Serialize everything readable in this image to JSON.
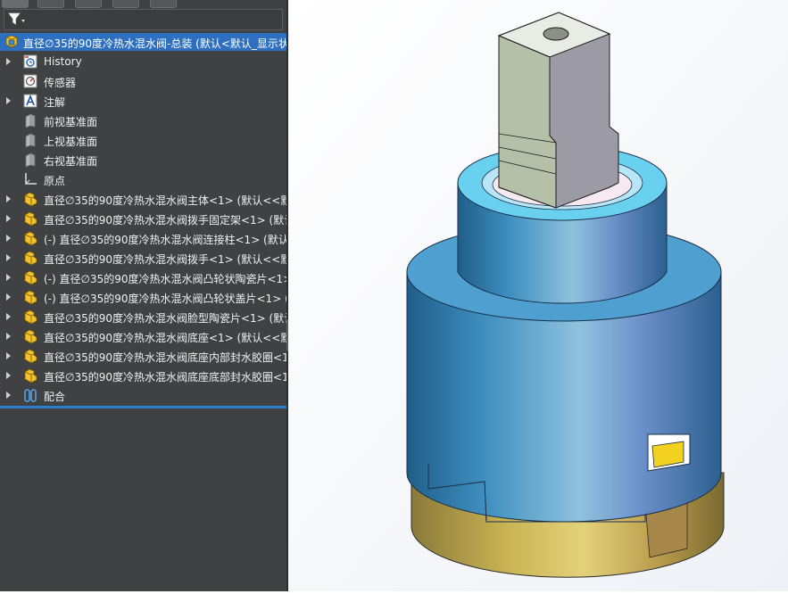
{
  "feature_tree": {
    "root": {
      "label": "直径∅35的90度冷热水混水阀-总装  (默认<默认_显示状"
    },
    "items": [
      {
        "label": "History",
        "icon": "history-icon",
        "expandable": true
      },
      {
        "label": "传感器",
        "icon": "sensor-icon",
        "expandable": false
      },
      {
        "label": "注解",
        "icon": "annotation-icon",
        "expandable": true
      },
      {
        "label": "前视基准面",
        "icon": "plane-icon",
        "expandable": false
      },
      {
        "label": "上视基准面",
        "icon": "plane-icon",
        "expandable": false
      },
      {
        "label": "右视基准面",
        "icon": "plane-icon",
        "expandable": false
      },
      {
        "label": "原点",
        "icon": "origin-icon",
        "expandable": false
      },
      {
        "label": "直径∅35的90度冷热水混水阀主体<1> (默认<<默",
        "icon": "part-icon",
        "expandable": true
      },
      {
        "label": "直径∅35的90度冷热水混水阀拨手固定架<1> (默认",
        "icon": "part-icon",
        "expandable": true
      },
      {
        "label": "(-) 直径∅35的90度冷热水混水阀连接柱<1> (默认",
        "icon": "part-icon",
        "expandable": true
      },
      {
        "label": "直径∅35的90度冷热水混水阀拨手<1> (默认<<默",
        "icon": "part-icon",
        "expandable": true
      },
      {
        "label": "(-) 直径∅35的90度冷热水混水阀凸轮状陶瓷片<1>",
        "icon": "part-icon",
        "expandable": true
      },
      {
        "label": "(-) 直径∅35的90度冷热水混水阀凸轮状盖片<1> (",
        "icon": "part-icon",
        "expandable": true
      },
      {
        "label": "直径∅35的90度冷热水混水阀脸型陶瓷片<1> (默认",
        "icon": "part-icon",
        "expandable": true
      },
      {
        "label": "直径∅35的90度冷热水混水阀底座<1> (默认<<默",
        "icon": "part-icon",
        "expandable": true
      },
      {
        "label": "直径∅35的90度冷热水混水阀底座内部封水胶圈<1",
        "icon": "part-icon",
        "expandable": true
      },
      {
        "label": "直径∅35的90度冷热水混水阀底座底部封水胶圈<1",
        "icon": "part-icon",
        "expandable": true
      },
      {
        "label": "配合",
        "icon": "mates-icon",
        "expandable": true
      }
    ]
  },
  "colors": {
    "panel_bg": "#3f4143",
    "selection": "#2e6fc0",
    "part_icon": "#f2c12e",
    "body_blue": "#3f8fc0",
    "stem_gray": "#8f9488",
    "base_gold": "#c9b253"
  }
}
